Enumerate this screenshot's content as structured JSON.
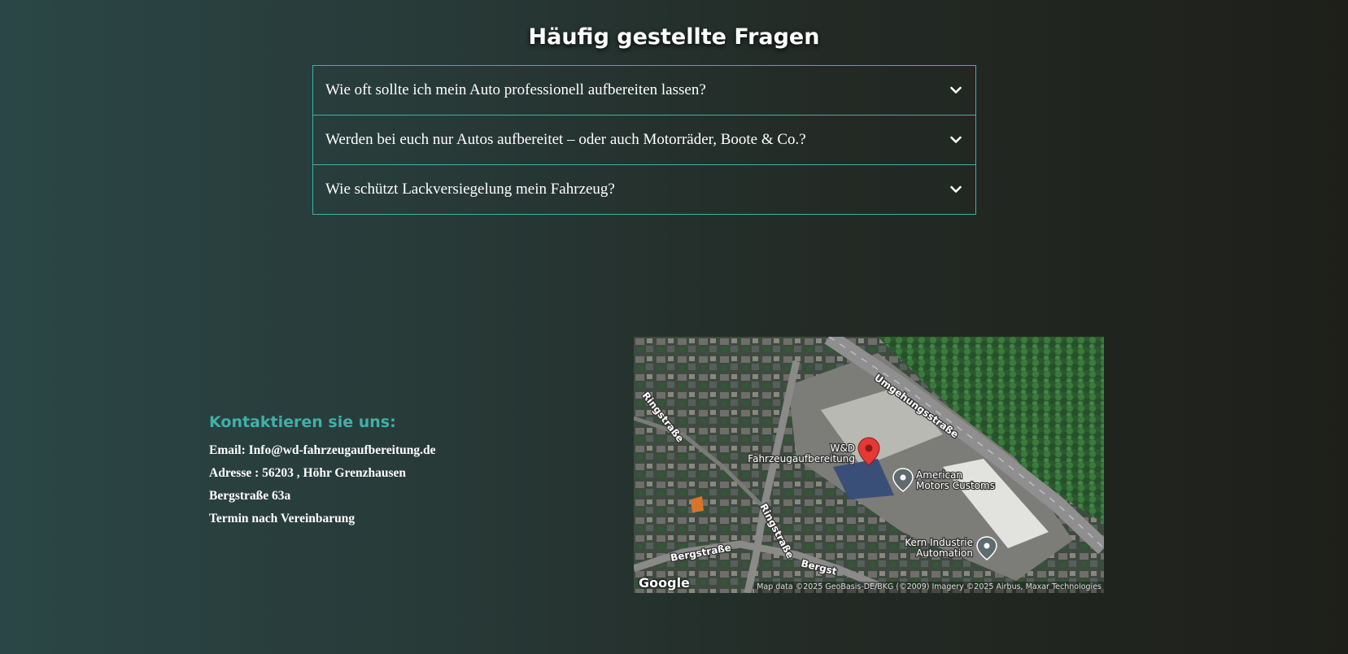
{
  "faq": {
    "title": "Häufig gestellte Fragen",
    "items": [
      {
        "question": "Wie oft sollte ich mein Auto professionell aufbereiten lassen?"
      },
      {
        "question": "Werden bei euch nur Autos aufbereitet – oder auch Motorräder, Boote & Co.?"
      },
      {
        "question": "Wie schützt Lackversiegelung mein Fahrzeug?"
      }
    ],
    "expand_icon": "chevron-down-icon"
  },
  "contact": {
    "title": "Kontaktieren sie uns:",
    "email": "Email: Info@wd-fahrzeugaufbereitung.de",
    "address": "Adresse : 56203 , Höhr Grenzhausen",
    "street": "Bergstraße 63a",
    "appointment": "Termin nach Vereinbarung"
  },
  "map": {
    "street_labels": {
      "umgehungsstrasse": "Umgehungsstraße",
      "ringstrasse_upper": "Ringstraße",
      "ringstrasse_lower": "Ringstraße",
      "bergstrasse": "Bergstraße",
      "bergstrasse_partial": "Bergst"
    },
    "places": {
      "wd_line1": "W&D",
      "wd_line2": "Fahrzeugaufbereitung",
      "american_line1": "American",
      "american_line2": "Motors Customs",
      "kern_line1": "Kern Industrie",
      "kern_line2": "Automation"
    },
    "logo": "Google",
    "attribution": "Map data ©2025 GeoBasis-DE/BKG (©2009) Imagery ©2025 Airbus, Maxar Technologies"
  },
  "colors": {
    "accent": "#3fb1a7",
    "marker": "#e53935"
  }
}
